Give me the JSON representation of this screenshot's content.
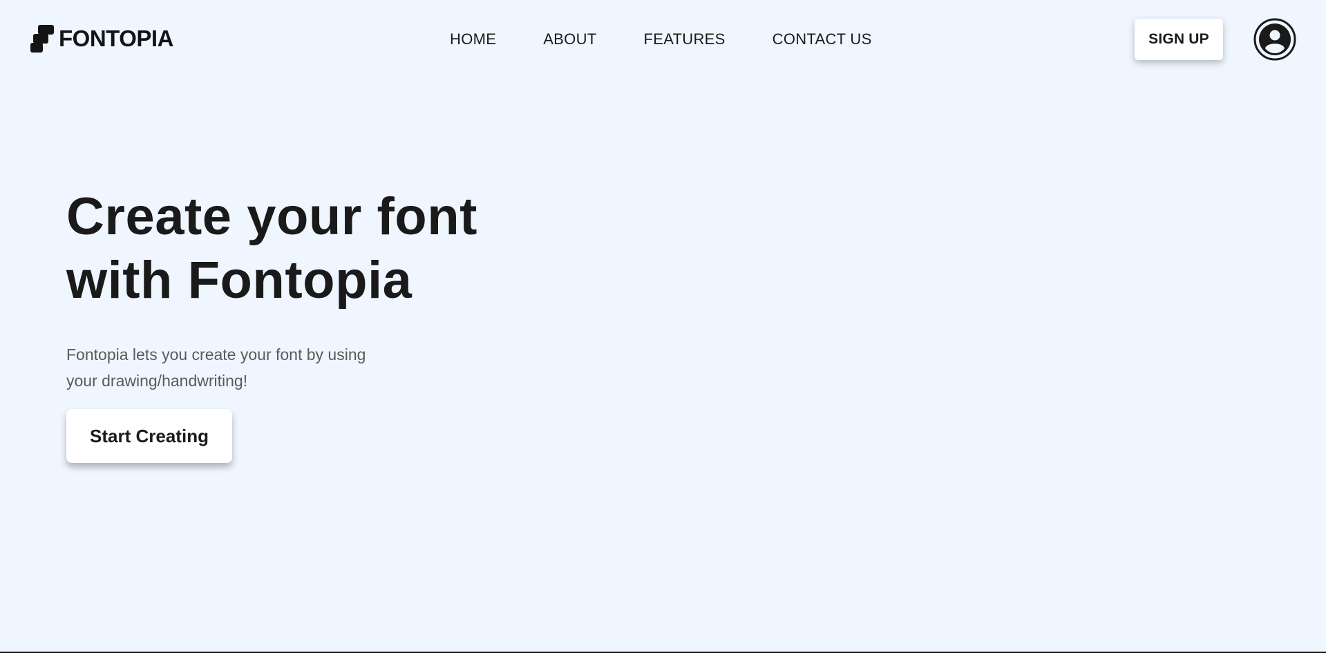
{
  "header": {
    "logo_text": "FONTOPIA",
    "logo_icon": "fontopia-logo-icon",
    "nav": [
      {
        "label": "HOME"
      },
      {
        "label": "ABOUT"
      },
      {
        "label": "FEATURES"
      },
      {
        "label": "CONTACT US"
      }
    ],
    "signup_label": "SIGN UP",
    "avatar_icon": "user-avatar-icon"
  },
  "hero": {
    "title_line1": "Create your font",
    "title_line2": "with Fontopia",
    "subtitle_line1": "Fontopia lets you create your font by using",
    "subtitle_line2": "your drawing/handwriting!",
    "cta_label": "Start Creating"
  },
  "colors": {
    "background": "#eff6ff",
    "text": "#1a1a1a",
    "subtext": "#5a5a5a",
    "button_bg": "#ffffff"
  }
}
